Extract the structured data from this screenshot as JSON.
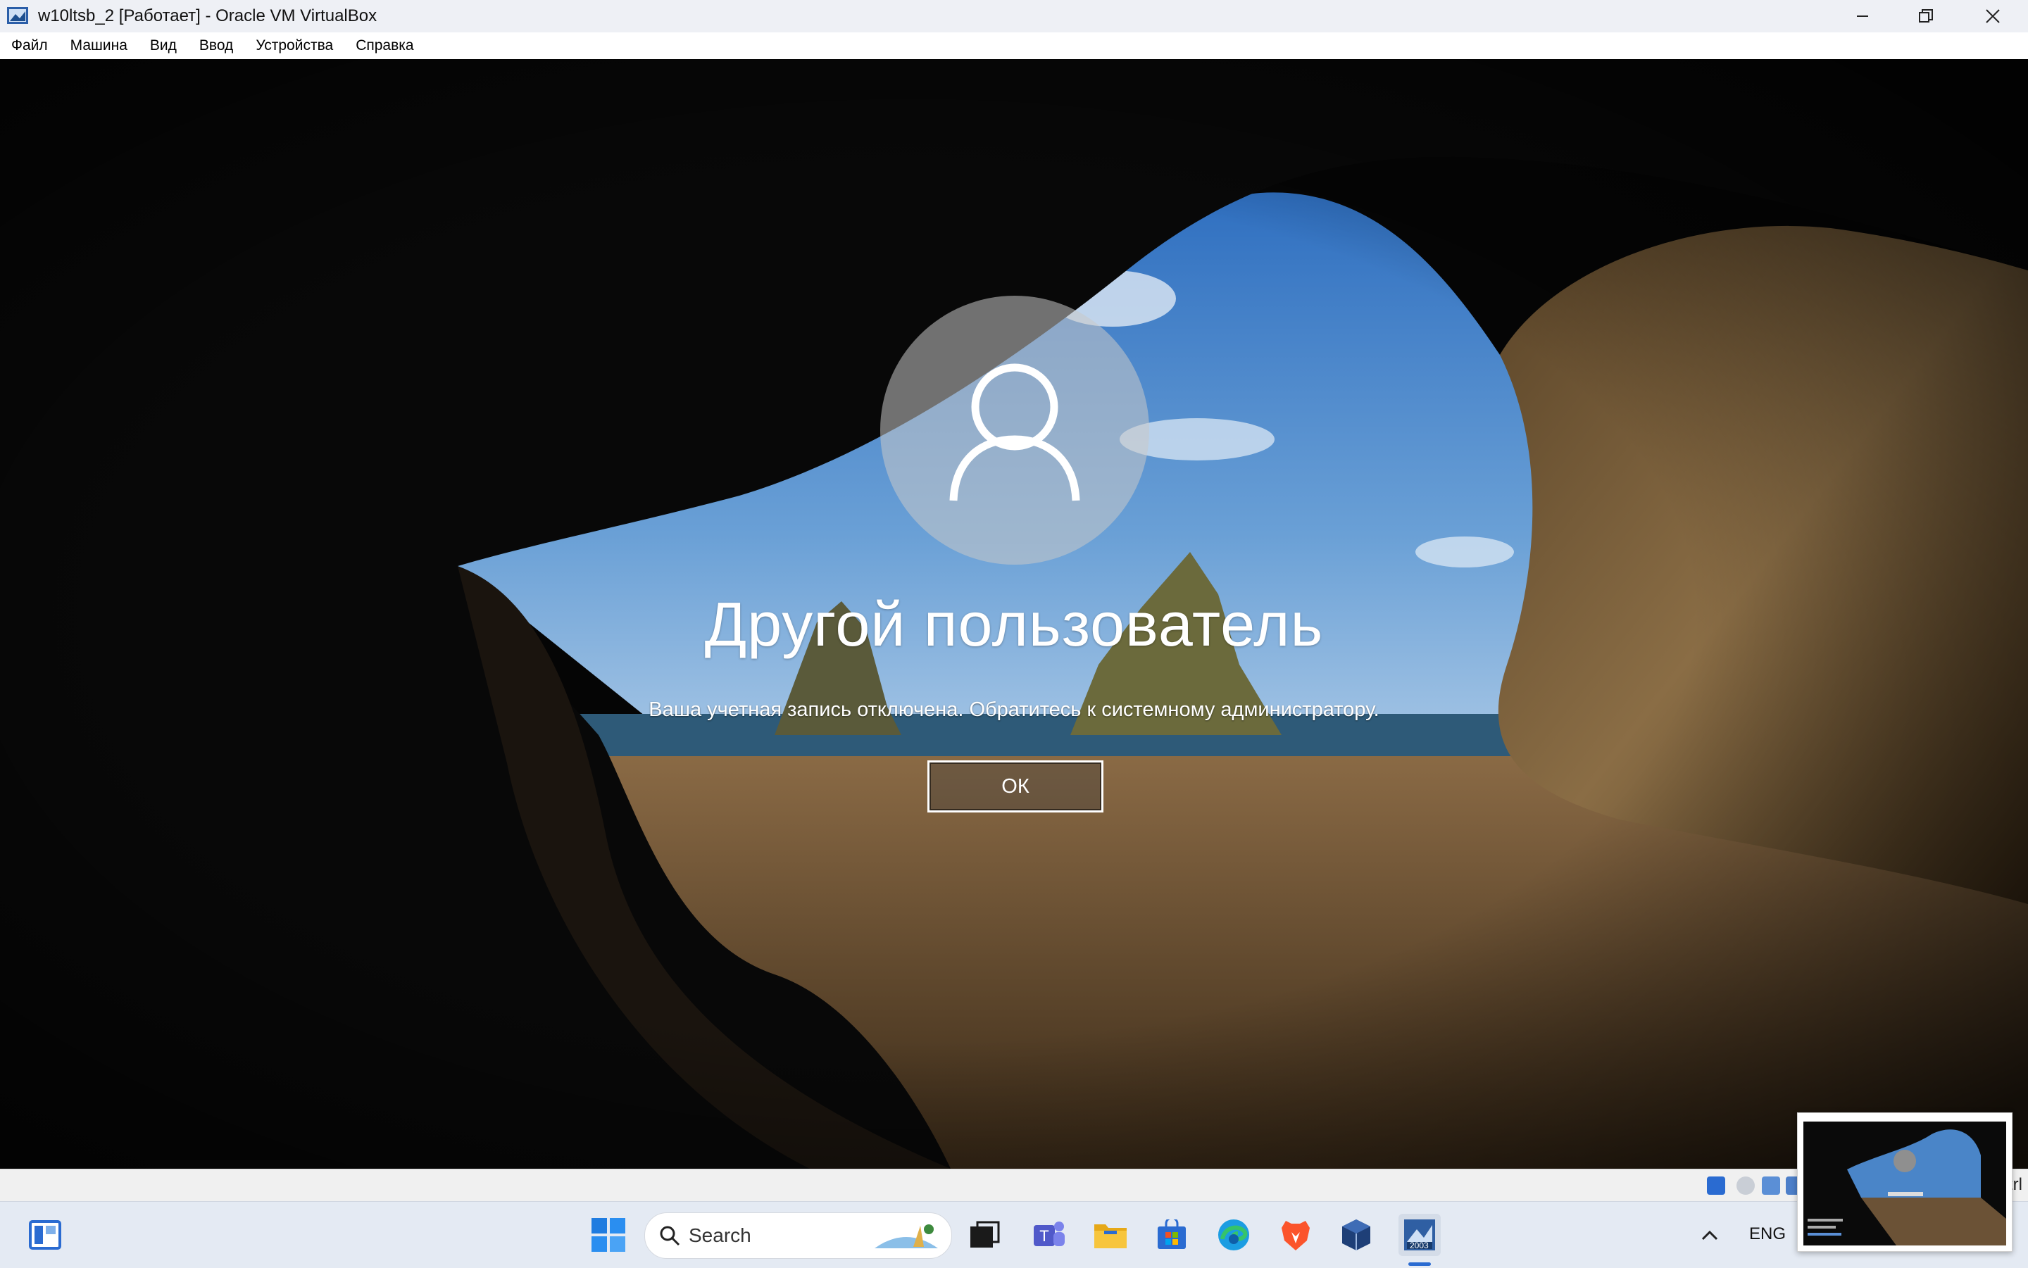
{
  "window": {
    "title": "w10ltsb_2 [Работает] - Oracle VM VirtualBox",
    "controls": [
      "minimize",
      "restore",
      "close"
    ]
  },
  "menu": {
    "items": [
      "Файл",
      "Машина",
      "Вид",
      "Ввод",
      "Устройства",
      "Справка"
    ]
  },
  "login": {
    "username": "Другой пользователь",
    "message": "Ваша учетная запись отключена. Обратитесь к системному администратору.",
    "ok_label": "ОК"
  },
  "statusbar": {
    "host_key_partial": "trl"
  },
  "taskbar": {
    "search_placeholder": "Search",
    "language": "ENG",
    "vbox_badge": "2003",
    "pinned": [
      "widgets-icon",
      "start-icon",
      "task-view-icon",
      "teams-icon",
      "file-explorer-icon",
      "store-icon",
      "edge-icon",
      "brave-icon",
      "virtualbox-icon",
      "virtualbox-vm-icon"
    ]
  }
}
